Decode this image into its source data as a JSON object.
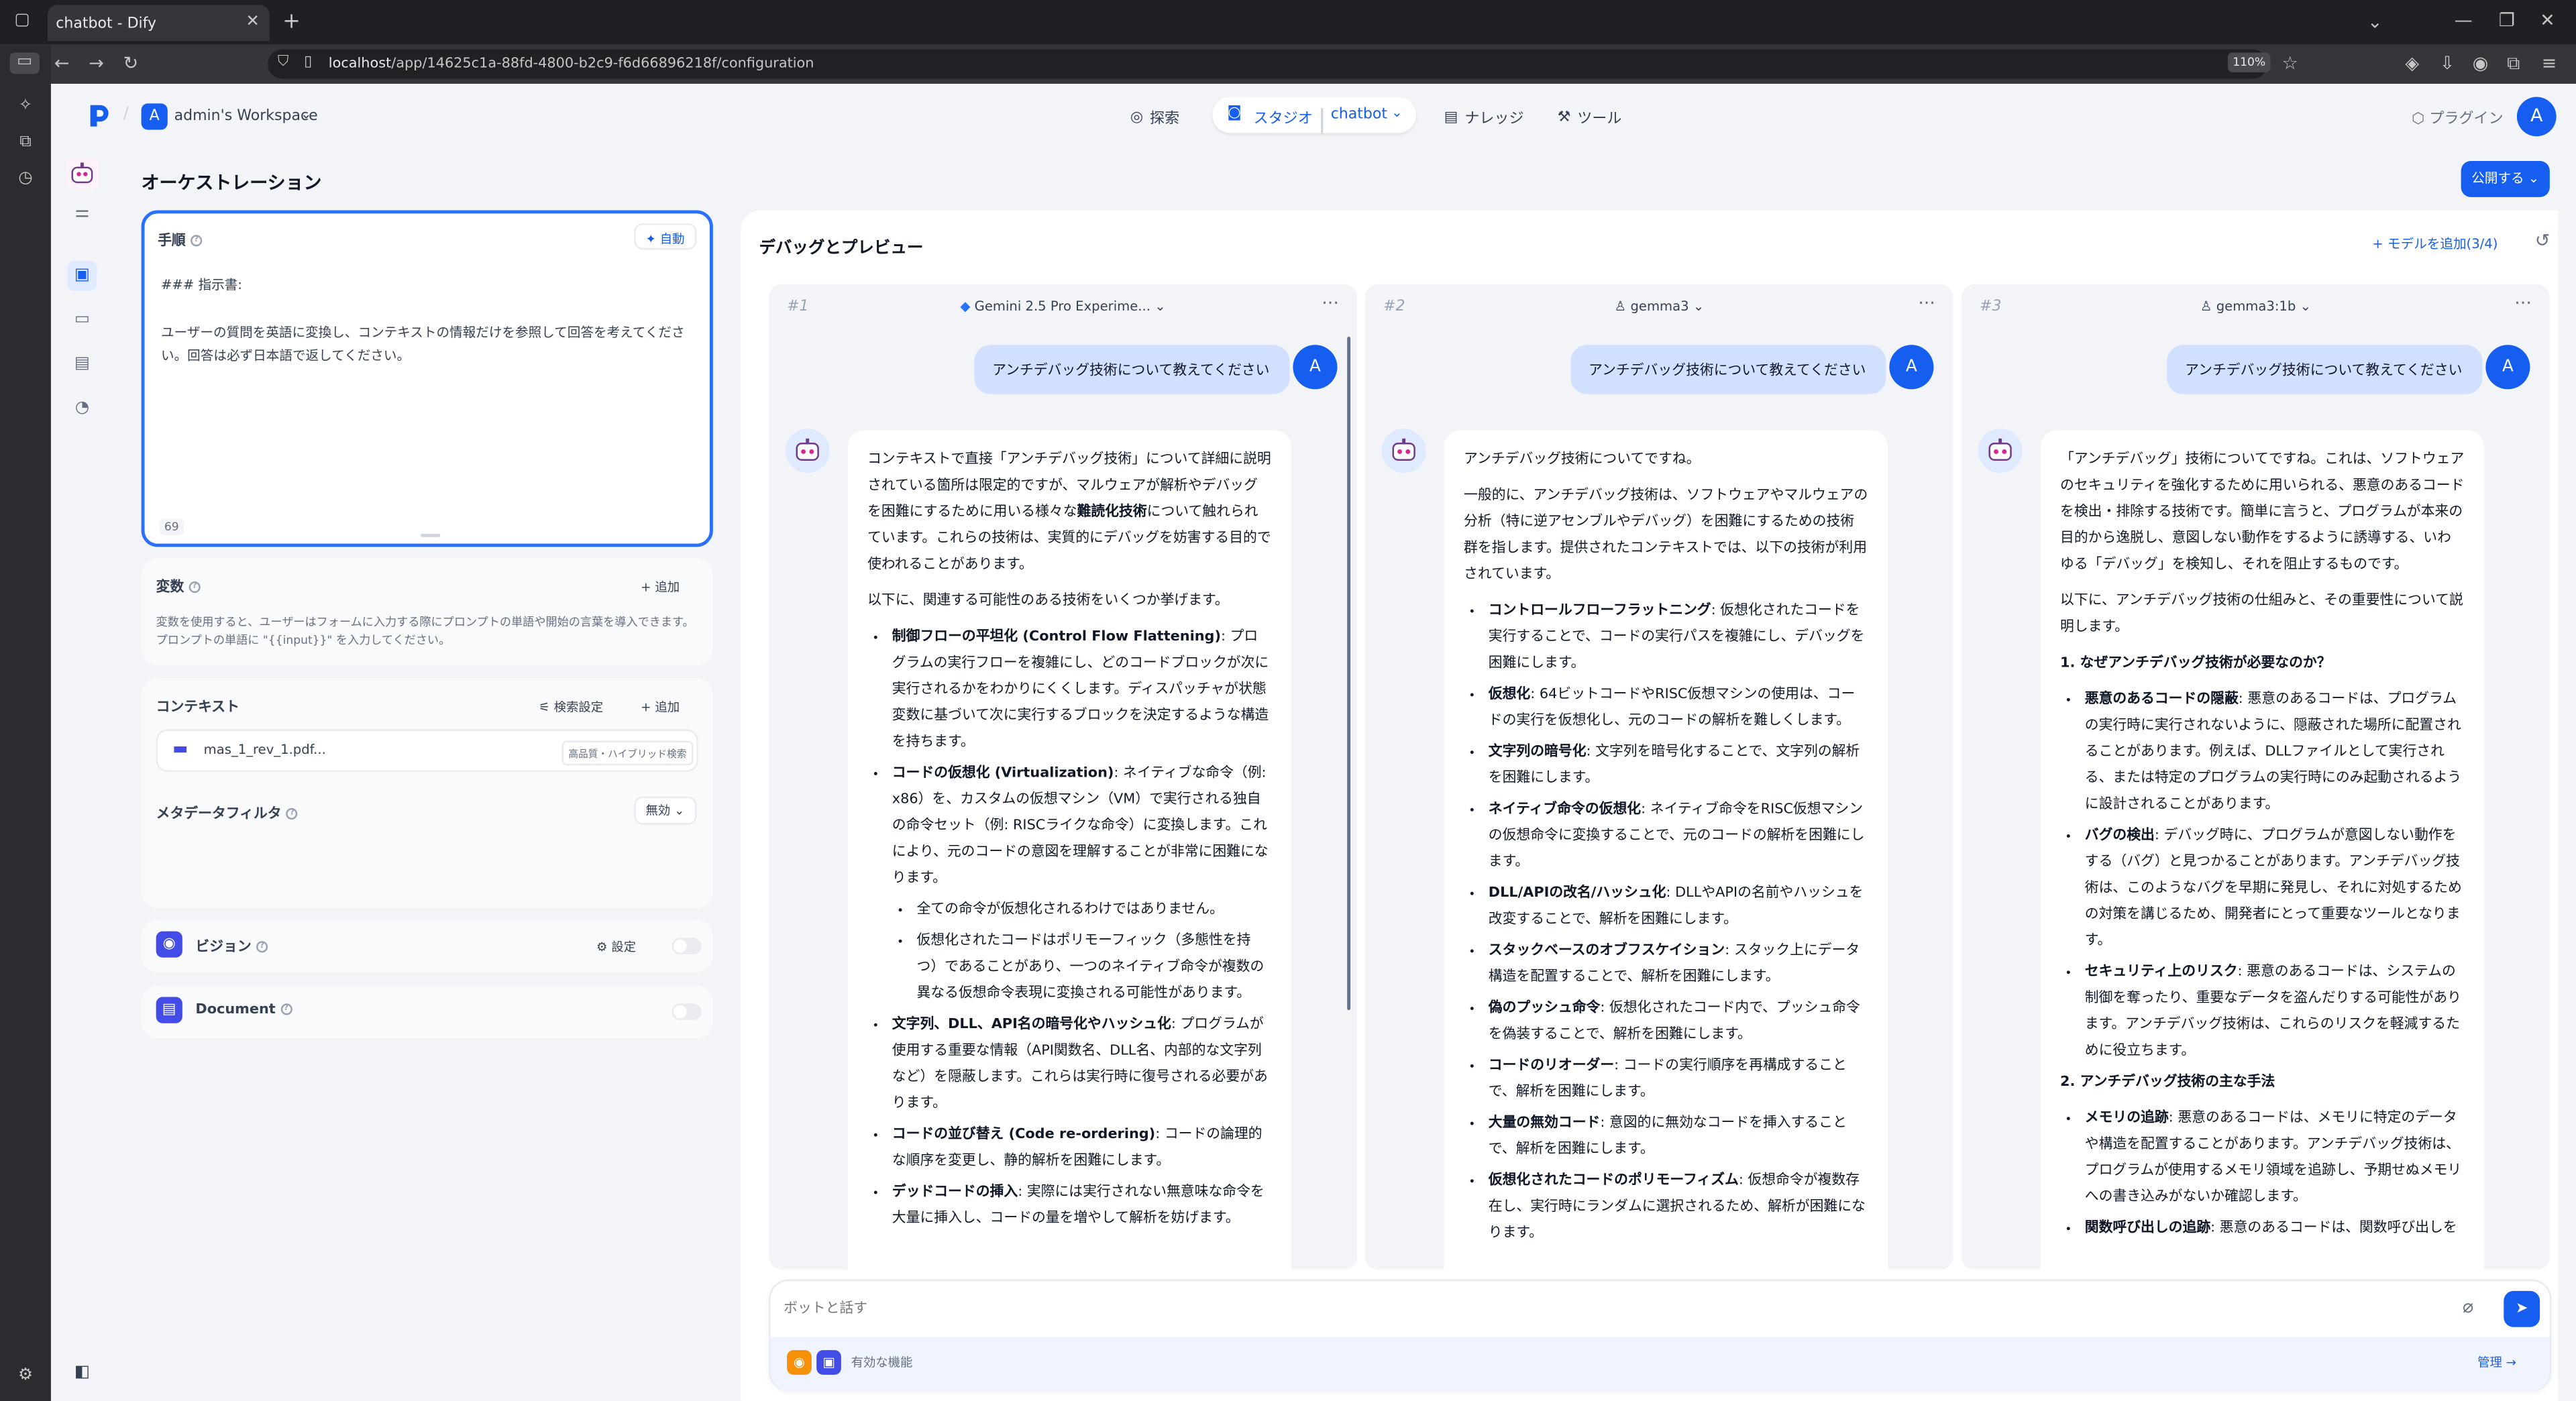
{
  "browser": {
    "tab_title": "chatbot - Dify",
    "url_host": "localhost",
    "url_path": "/app/14625c1a-88fd-4800-b2c9-f6d66896218f/configuration",
    "zoom": "110%"
  },
  "header": {
    "workspace_initial": "A",
    "workspace": "admin's Workspace",
    "nav": {
      "explore": "探索",
      "studio": "スタジオ",
      "app": "chatbot",
      "knowledge": "ナレッジ",
      "tools": "ツール"
    },
    "plugin": "プラグイン",
    "avatar": "A"
  },
  "page": {
    "title": "オーケストレーション",
    "publish": "公開する"
  },
  "instructions": {
    "label": "手順",
    "auto": "自動",
    "line1": "### 指示書:",
    "line2": "ユーザーの質問を英語に変換し、コンテキストの情報だけを参照して回答を考えてください。回答は必ず日本語で返してください。",
    "count": "69"
  },
  "variables": {
    "label": "変数",
    "add": "追加",
    "desc": "変数を使用すると、ユーザーはフォームに入力する際にプロンプトの単語や開始の言葉を導入できます。プロンプトの単語に \"{{input}}\" を入力してください。"
  },
  "context": {
    "label": "コンテキスト",
    "retrieval": "検索設定",
    "add": "追加",
    "file": "mas_1_rev_1.pdf...",
    "file_tag": "高品質・ハイブリッド検索",
    "meta_label": "メタデータフィルタ",
    "meta_value": "無効"
  },
  "vision": {
    "label": "ビジョン",
    "settings": "設定"
  },
  "document": {
    "label": "Document"
  },
  "debug": {
    "title": "デバッグとプレビュー",
    "add_model": "モデルを追加(3/4)",
    "input_placeholder": "ボットと話す",
    "features": "有効な機能",
    "manage": "管理"
  },
  "user_question": "アンチデバッグ技術について教えてください",
  "user_initial": "A",
  "columns": [
    {
      "num": "#1",
      "model": "Gemini 2.5 Pro Experime...",
      "p1a": "コンテキストで直接「アンチデバッグ技術」について詳細に説明されている箇所は限定的ですが、マルウェアが解析やデバッグを困難にするために用いる様々な",
      "p1b": "難読化技術",
      "p1c": "について触れられています。これらの技術は、実質的にデバッグを妨害する目的で使われることがあります。",
      "p2": "以下に、関連する可能性のある技術をいくつか挙げます。",
      "items": [
        {
          "h": "制御フローの平坦化 (Control Flow Flattening)",
          "t": ": プログラムの実行フローを複雑にし、どのコードブロックが次に実行されるかをわかりにくくします。ディスパッチャが状態変数に基づいて次に実行するブロックを決定するような構造を持ちます。"
        },
        {
          "h": "コードの仮想化 (Virtualization)",
          "t": ": ネイティブな命令（例: x86）を、カスタムの仮想マシン（VM）で実行される独自の命令セット（例: RISCライクな命令）に変換します。これにより、元のコードの意図を理解することが非常に困難になります。"
        },
        {
          "h": "文字列、DLL、API名の暗号化やハッシュ化",
          "t": ": プログラムが使用する重要な情報（API関数名、DLL名、内部的な文字列など）を隠蔽します。これらは実行時に復号される必要があります。"
        },
        {
          "h": "コードの並び替え (Code re-ordering)",
          "t": ": コードの論理的な順序を変更し、静的解析を困難にします。"
        },
        {
          "h": "デッドコードの挿入",
          "t": ": 実際には実行されない無意味な命令を大量に挿入し、コードの量を増やして解析を妨げます。"
        }
      ],
      "sub": [
        "全ての命令が仮想化されるわけではありません。",
        "仮想化されたコードはポリモーフィック（多態性を持つ）であることがあり、一つのネイティブ命令が複数の異なる仮想命令表現に変換される可能性があります。"
      ]
    },
    {
      "num": "#2",
      "model": "gemma3",
      "p1": "アンチデバッグ技術についてですね。",
      "p2": "一般的に、アンチデバッグ技術は、ソフトウェアやマルウェアの分析（特に逆アセンブルやデバッグ）を困難にするための技術群を指します。提供されたコンテキストでは、以下の技術が利用されています。",
      "items": [
        {
          "h": "コントロールフローフラットニング",
          "t": ": 仮想化されたコードを実行することで、コードの実行パスを複雑にし、デバッグを困難にします。"
        },
        {
          "h": "仮想化",
          "t": ": 64ビットコードやRISC仮想マシンの使用は、コードの実行を仮想化し、元のコードの解析を難しくします。"
        },
        {
          "h": "文字列の暗号化",
          "t": ": 文字列を暗号化することで、文字列の解析を困難にします。"
        },
        {
          "h": "ネイティブ命令の仮想化",
          "t": ": ネイティブ命令をRISC仮想マシンの仮想命令に変換することで、元のコードの解析を困難にします。"
        },
        {
          "h": "DLL/APIの改名/ハッシュ化",
          "t": ": DLLやAPIの名前やハッシュを改変することで、解析を困難にします。"
        },
        {
          "h": "スタックベースのオブフスケイション",
          "t": ": スタック上にデータ構造を配置することで、解析を困難にします。"
        },
        {
          "h": "偽のプッシュ命令",
          "t": ": 仮想化されたコード内で、プッシュ命令を偽装することで、解析を困難にします。"
        },
        {
          "h": "コードのリオーダー",
          "t": ": コードの実行順序を再構成することで、解析を困難にします。"
        },
        {
          "h": "大量の無効コード",
          "t": ": 意図的に無効なコードを挿入することで、解析を困難にします。"
        },
        {
          "h": "仮想化されたコードのポリモーフィズム",
          "t": ": 仮想命令が複数存在し、実行時にランダムに選択されるため、解析が困難になります。"
        }
      ]
    },
    {
      "num": "#3",
      "model": "gemma3:1b",
      "p1": "「アンチデバッグ」技術についてですね。これは、ソフトウェアのセキュリティを強化するために用いられる、悪意のあるコードを検出・排除する技術です。簡単に言うと、プログラムが本来の目的から逸脱し、意図しない動作をするように誘導する、いわゆる「デバッグ」を検知し、それを阻止するものです。",
      "p2": "以下に、アンチデバッグ技術の仕組みと、その重要性について説明します。",
      "h1": "1. なぜアンチデバッグ技術が必要なのか？",
      "items": [
        {
          "h": "悪意のあるコードの隠蔽",
          "t": ": 悪意のあるコードは、プログラムの実行時に実行されないように、隠蔽された場所に配置されることがあります。例えば、DLLファイルとして実行される、または特定のプログラムの実行時にのみ起動されるように設計されることがあります。"
        },
        {
          "h": "バグの検出",
          "t": ": デバッグ時に、プログラムが意図しない動作をする（バグ）と見つかることがあります。アンチデバッグ技術は、このようなバグを早期に発見し、それに対処するための対策を講じるため、開発者にとって重要なツールとなります。"
        },
        {
          "h": "セキュリティ上のリスク",
          "t": ": 悪意のあるコードは、システムの制御を奪ったり、重要なデータを盗んだりする可能性があります。アンチデバッグ技術は、これらのリスクを軽減するために役立ちます。"
        }
      ],
      "h2": "2. アンチデバッグ技術の主な手法",
      "items2": [
        {
          "h": "メモリの追跡",
          "t": ": 悪意のあるコードは、メモリに特定のデータや構造を配置することがあります。アンチデバッグ技術は、プログラムが使用するメモリ領域を追跡し、予期せぬメモリへの書き込みがないか確認します。"
        },
        {
          "h": "関数呼び出しの追跡",
          "t": ": 悪意のあるコードは、関数呼び出しを"
        }
      ]
    }
  ]
}
